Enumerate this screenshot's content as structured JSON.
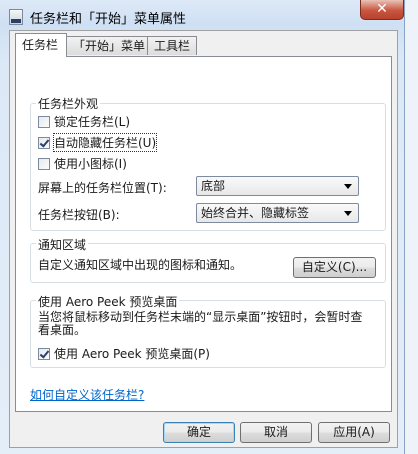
{
  "window": {
    "title": "任务栏和「开始」菜单属性",
    "close_glyph": "✕"
  },
  "tabs": [
    {
      "label": "任务栏",
      "active": true
    },
    {
      "label": "「开始」菜单",
      "active": false
    },
    {
      "label": "工具栏",
      "active": false
    }
  ],
  "appearance": {
    "label": "任务栏外观",
    "lock": {
      "label": "锁定任务栏(L)",
      "checked": false
    },
    "autohide": {
      "label": "自动隐藏任务栏(U)",
      "checked": true
    },
    "small_icons": {
      "label": "使用小图标(I)",
      "checked": false
    },
    "location": {
      "label": "屏幕上的任务栏位置(T):",
      "value": "底部"
    },
    "buttons": {
      "label": "任务栏按钮(B):",
      "value": "始终合并、隐藏标签"
    }
  },
  "notify": {
    "label": "通知区域",
    "description": "自定义通知区域中出现的图标和通知。",
    "customize_button": "自定义(C)..."
  },
  "aero": {
    "label": "使用 Aero Peek 预览桌面",
    "description": "当您将鼠标移动到任务栏末端的“显示桌面”按钮时，会暂时查看桌面。",
    "checkbox": {
      "label": "使用 Aero Peek 预览桌面(P)",
      "checked": true
    }
  },
  "help_link": "如何自定义该任务栏?",
  "footer": {
    "ok": "确定",
    "cancel": "取消",
    "apply": "应用(A)"
  }
}
